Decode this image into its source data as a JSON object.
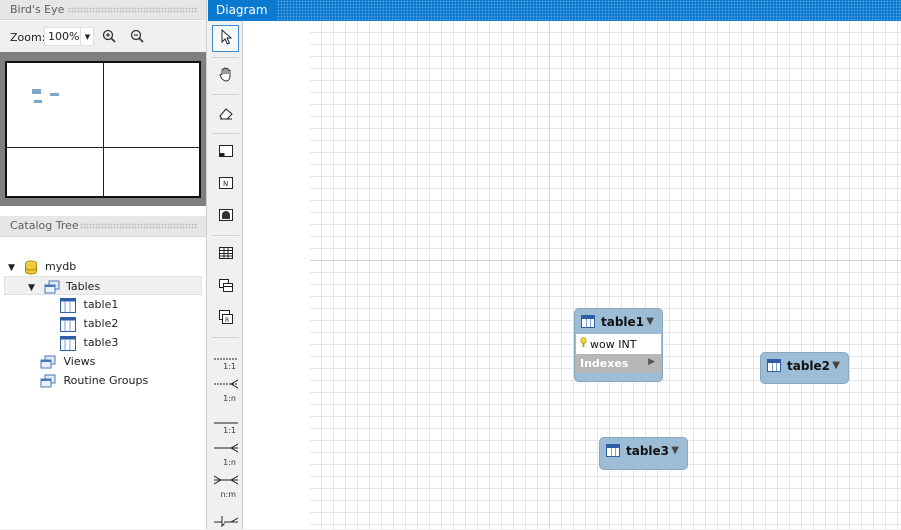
{
  "birds_eye": {
    "title": "Bird's Eye",
    "zoom_label": "Zoom:",
    "zoom_value": "100%"
  },
  "catalog": {
    "title": "Catalog Tree",
    "schema": "mydb",
    "tables_label": "Tables",
    "tables": [
      "table1",
      "table2",
      "table3"
    ],
    "views_label": "Views",
    "routines_label": "Routine Groups"
  },
  "diagram": {
    "title": "Diagram",
    "tables": [
      {
        "name": "table1",
        "columns": [
          "wow INT"
        ],
        "indexes_label": "Indexes"
      },
      {
        "name": "table2"
      },
      {
        "name": "table3"
      }
    ]
  },
  "toolbar": {
    "rel_1_1_a": "1:1",
    "rel_1_n_a": "1:n",
    "rel_1_1_b": "1:1",
    "rel_1_n_b": "1:n",
    "rel_n_m": "n:m"
  }
}
